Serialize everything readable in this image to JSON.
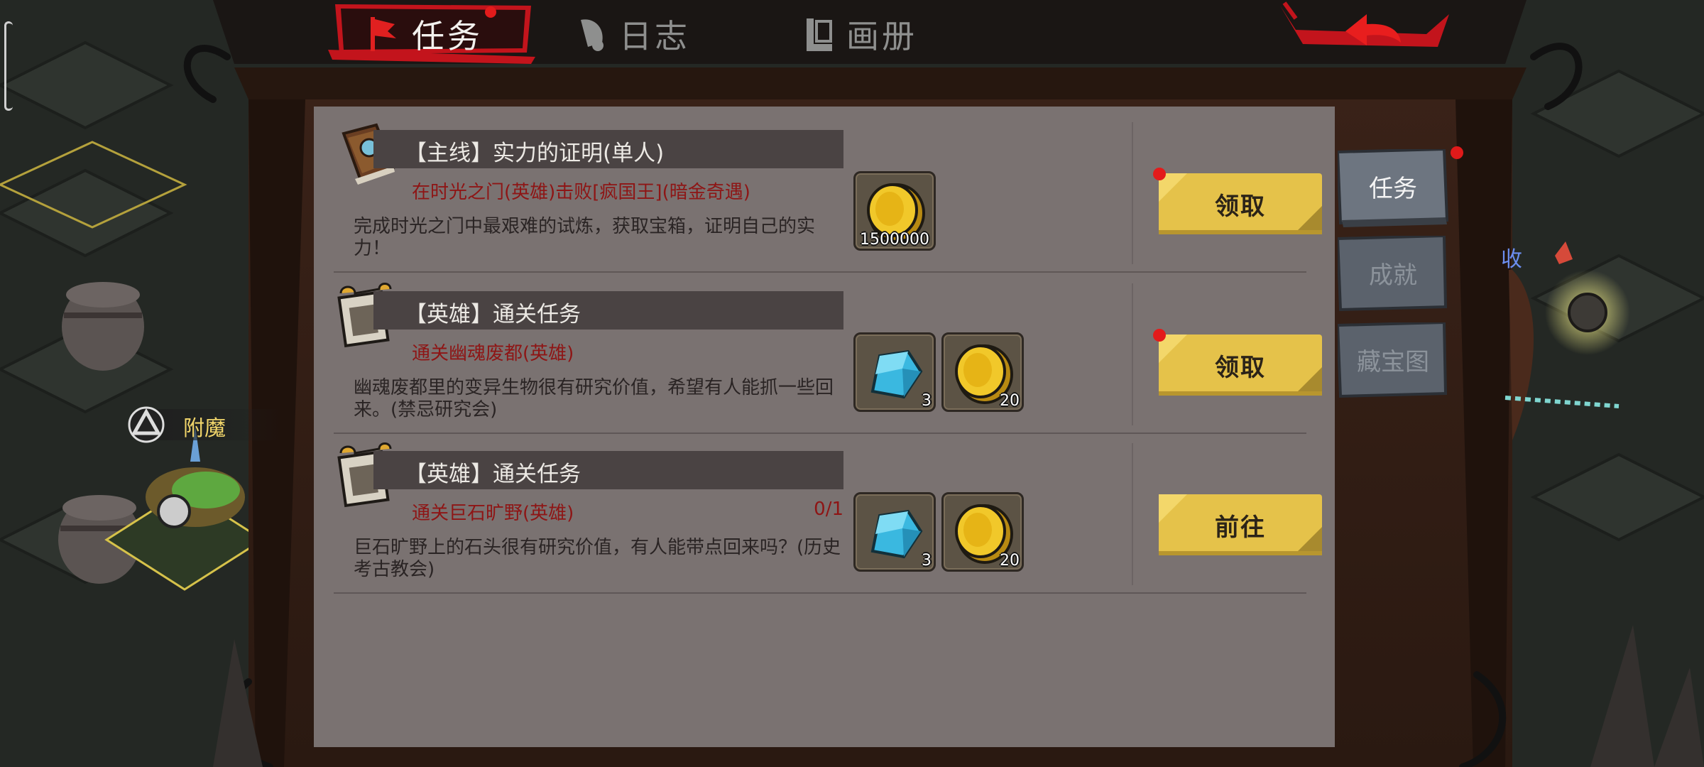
{
  "top_tabs": [
    {
      "label": "任务",
      "icon": "quest-flag-icon",
      "active": true
    },
    {
      "label": "日志",
      "icon": "quill-icon",
      "active": false
    },
    {
      "label": "画册",
      "icon": "album-icon",
      "active": false
    }
  ],
  "back_button": {
    "icon": "back-arrow-icon"
  },
  "quests": [
    {
      "icon": "main-quest-book-icon",
      "title": "【主线】实力的证明(单人)",
      "goal": "在时光之门(英雄)击败[疯国王](暗金奇遇)",
      "progress": "",
      "description": "完成时光之门中最艰难的试炼，获取宝箱，证明自己的实力！",
      "rewards": [
        {
          "type": "gold-coin-icon",
          "count": "1500000"
        }
      ],
      "action": "领取",
      "has_alert": true
    },
    {
      "icon": "hero-quest-scroll-icon",
      "title": "【英雄】通关任务",
      "goal": "通关幽魂废都(英雄)",
      "progress": "",
      "description": "幽魂废都里的变异生物很有研究价值，希望有人能抓一些回来。(禁忌研究会)",
      "rewards": [
        {
          "type": "blue-crystal-icon",
          "count": "3"
        },
        {
          "type": "gold-coin-icon",
          "count": "20"
        }
      ],
      "action": "领取",
      "has_alert": true
    },
    {
      "icon": "hero-quest-scroll-icon",
      "title": "【英雄】通关任务",
      "goal": "通关巨石旷野(英雄)",
      "progress": "0/1",
      "description": "巨石旷野上的石头很有研究价值，有人能带点回来吗？(历史考古教会)",
      "rewards": [
        {
          "type": "blue-crystal-icon",
          "count": "3"
        },
        {
          "type": "gold-coin-icon",
          "count": "20"
        }
      ],
      "action": "前往",
      "has_alert": false
    }
  ],
  "side_tabs": [
    {
      "label": "任务",
      "active": true
    },
    {
      "label": "成就",
      "active": false
    },
    {
      "label": "藏宝图",
      "active": false
    }
  ],
  "world": {
    "enchant_label": "附魔",
    "side_fragment": "收"
  },
  "colors": {
    "panel": "#7a7271",
    "title_bar": "#4a4343",
    "goal_text": "#8e1515",
    "button_gold": "#e5c24a",
    "alert_red": "#e31b1b",
    "tab_red": "#c3141c"
  }
}
